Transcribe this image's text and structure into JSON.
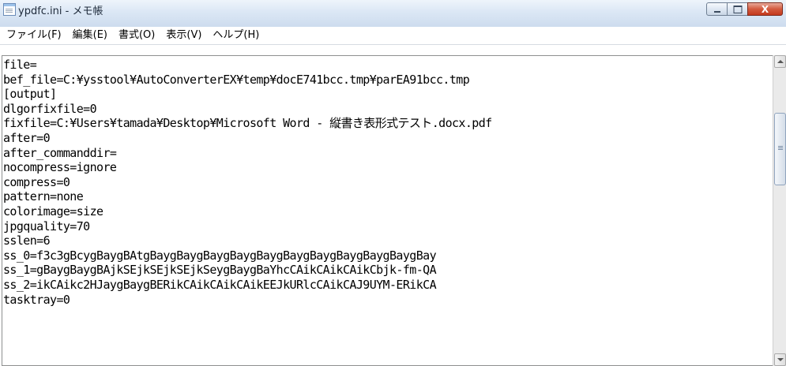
{
  "window": {
    "title": "ypdfc.ini - メモ帳",
    "icon": "notepad-icon"
  },
  "caption": {
    "minimize_icon": "minimize-icon",
    "maximize_icon": "maximize-icon",
    "close_icon": "close-icon",
    "close_glyph": "X"
  },
  "menu": {
    "items": [
      {
        "label": "ファイル(F)"
      },
      {
        "label": "編集(E)"
      },
      {
        "label": "書式(O)"
      },
      {
        "label": "表示(V)"
      },
      {
        "label": "ヘルプ(H)"
      }
    ]
  },
  "editor": {
    "lines": [
      "file=",
      "bef_file=C:¥ysstool¥AutoConverterEX¥temp¥docE741bcc.tmp¥parEA91bcc.tmp",
      "[output]",
      "dlgorfixfile=0",
      "fixfile=C:¥Users¥tamada¥Desktop¥Microsoft Word - 縦書き表形式テスト.docx.pdf",
      "after=0",
      "after_commanddir=",
      "nocompress=ignore",
      "compress=0",
      "pattern=none",
      "colorimage=size",
      "jpgquality=70",
      "sslen=6",
      "ss_0=f3c3gBcygBaygBAtgBaygBaygBaygBaygBaygBaygBaygBaygBaygBaygBay",
      "ss_1=gBaygBaygBAjkSEjkSEjkSEjkSeygBaygBaYhcCAikCAikCAikCbjk-fm-QA",
      "ss_2=ikCAikc2HJaygBaygBERikCAikCAikCAikEEJkURlcCAikCAJ9UYM-ERikCA",
      "tasktray=0"
    ]
  },
  "scrollbar": {
    "up_icon": "scroll-up-arrow-icon",
    "down_icon": "scroll-down-arrow-icon"
  }
}
